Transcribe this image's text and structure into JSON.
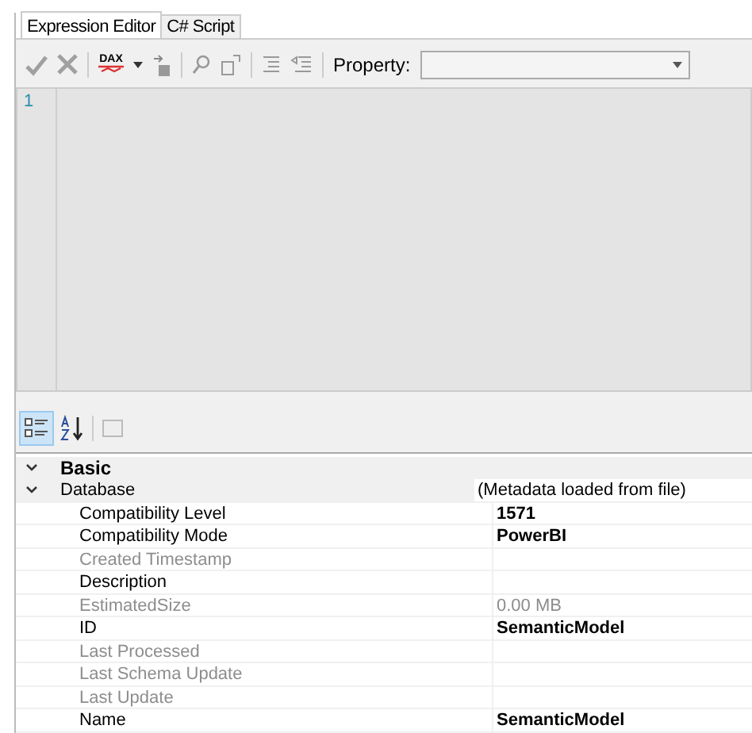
{
  "tabs": [
    {
      "label": "Expression Editor",
      "selected": true
    },
    {
      "label": "C# Script",
      "selected": false
    }
  ],
  "toolbar": {
    "property_label": "Property:",
    "dax_label": "DAX"
  },
  "editor": {
    "line_numbers": [
      "1"
    ]
  },
  "property_grid": {
    "categories": [
      {
        "label": "Basic",
        "expanded": true,
        "children": [
          {
            "label": "Database",
            "expanded": true,
            "value": "(Metadata loaded from file)",
            "disabled": false,
            "modified": false,
            "children": [
              {
                "label": "Compatibility Level",
                "value": "1571",
                "disabled": false,
                "modified": true
              },
              {
                "label": "Compatibility Mode",
                "value": "PowerBI",
                "disabled": false,
                "modified": true
              },
              {
                "label": "Created Timestamp",
                "disabled": true
              },
              {
                "label": "Description",
                "disabled": false
              },
              {
                "label": "EstimatedSize",
                "value": "0.00 MB",
                "disabled": true,
                "modified": false
              },
              {
                "label": "ID",
                "value": "SemanticModel",
                "disabled": false,
                "modified": true
              },
              {
                "label": "Last Processed",
                "disabled": true
              },
              {
                "label": "Last Schema Update",
                "disabled": true
              },
              {
                "label": "Last Update",
                "disabled": true
              },
              {
                "label": "Name",
                "value": "SemanticModel",
                "disabled": false,
                "modified": true
              }
            ]
          }
        ]
      }
    ]
  }
}
